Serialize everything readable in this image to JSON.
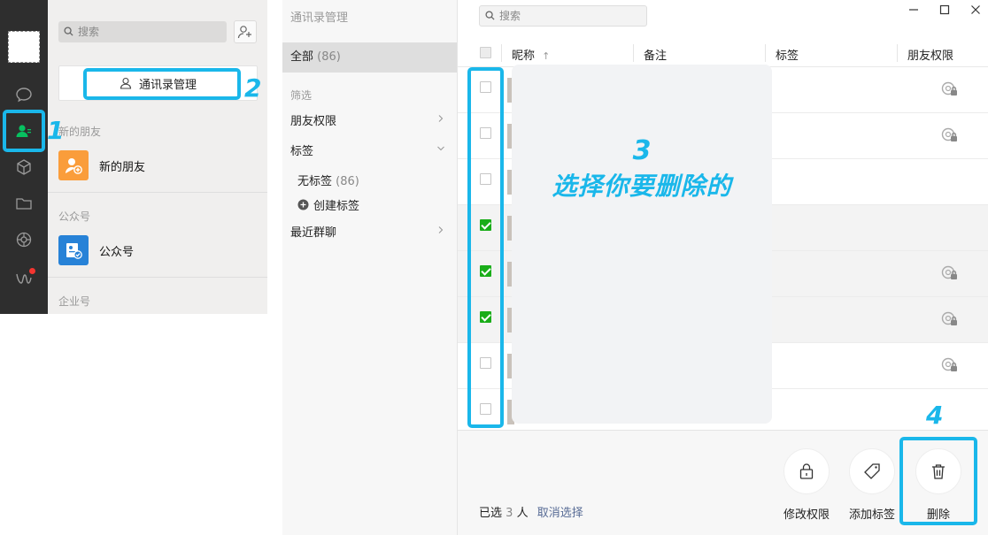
{
  "contacts_pane": {
    "search_placeholder": "搜索",
    "manage_button": "通讯录管理",
    "section_new_friends": "新的朋友",
    "new_friends_item": "新的朋友",
    "section_official": "公众号",
    "official_item": "公众号",
    "section_enterprise": "企业号"
  },
  "filter": {
    "title": "通讯录管理",
    "all_label": "全部",
    "all_count": "(86)",
    "filter_heading": "筛选",
    "friend_permission": "朋友权限",
    "tags": "标签",
    "no_tag": "无标签",
    "no_tag_count": "(86)",
    "create_tag": "创建标签",
    "recent_groups": "最近群聊"
  },
  "table": {
    "search_placeholder": "搜索",
    "columns": [
      "昵称",
      "备注",
      "标签",
      "朋友权限"
    ],
    "sort_arrow": "↑",
    "rows": [
      {
        "checked": false,
        "perm_icon": true
      },
      {
        "checked": false,
        "perm_icon": true
      },
      {
        "checked": false,
        "perm_icon": false
      },
      {
        "checked": true,
        "perm_icon": false
      },
      {
        "checked": true,
        "perm_icon": true
      },
      {
        "checked": true,
        "perm_icon": true
      },
      {
        "checked": false,
        "perm_icon": true
      },
      {
        "checked": false,
        "perm_icon": false
      }
    ]
  },
  "bottom": {
    "selected_prefix": "已选",
    "selected_count": "3",
    "selected_suffix": "人",
    "cancel_selection": "取消选择",
    "actions": [
      "修改权限",
      "添加标签",
      "删除"
    ]
  },
  "annotations": {
    "step1": "1",
    "step2": "2",
    "step3_num": "3",
    "step3_text": "选择你要删除的",
    "step4": "4",
    "color": "#1ab7ea"
  }
}
